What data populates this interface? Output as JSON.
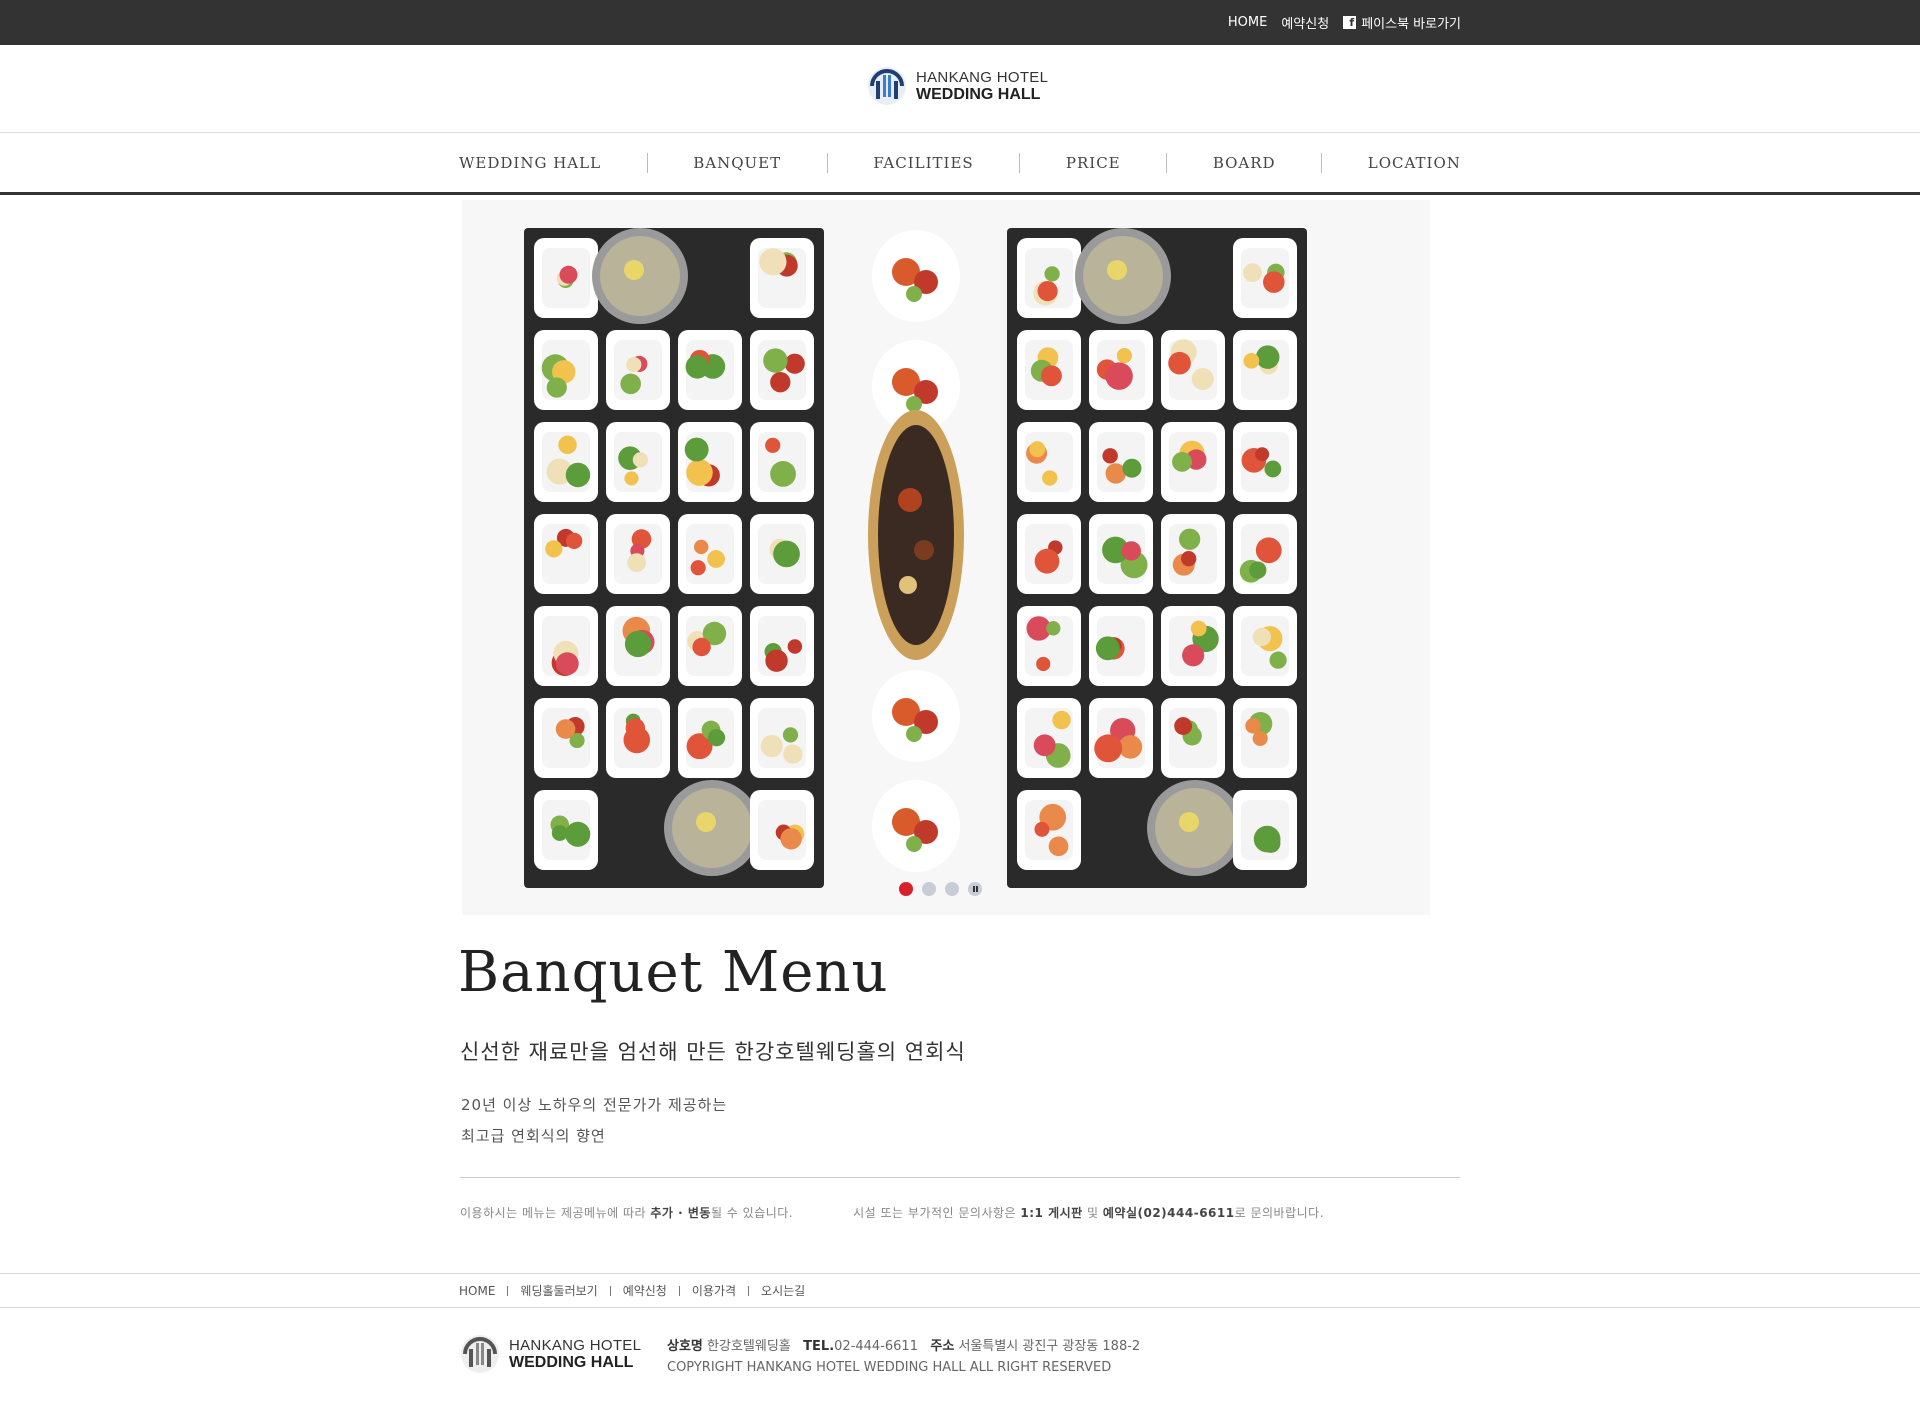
{
  "topbar": {
    "home": "HOME",
    "reserve": "예약신청",
    "facebook_icon": "f",
    "facebook": "페이스북 바로가기"
  },
  "logo": {
    "line1": "HANKANG HOTEL",
    "line2": "WEDDING HALL"
  },
  "nav": {
    "items": [
      "WEDDING HALL",
      "BANQUET",
      "FACILITIES",
      "PRICE",
      "BOARD",
      "LOCATION"
    ]
  },
  "slider": {
    "dots": 3,
    "active_index": 0
  },
  "content": {
    "title": "Banquet Menu",
    "subtitle": "신선한 재료만을 엄선해 만든 한강호텔웨딩홀의 연회식",
    "desc_line1": "20년 이상 노하우의 전문가가 제공하는",
    "desc_line2": "최고급 연회식의 향연",
    "notice1_a": "이용하시는 메뉴는 제공메뉴에 따라 ",
    "notice1_b": "추가 · 변동",
    "notice1_c": "될 수 있습니다.",
    "notice2_a": "시설 또는 부가적인 문의사항은 ",
    "notice2_b": "1:1 게시판",
    "notice2_c": " 및 ",
    "notice2_d": "예약실(02)444-6611",
    "notice2_e": "로 문의바랍니다."
  },
  "footer_nav": [
    "HOME",
    "웨딩홀둘러보기",
    "예약신청",
    "이용가격",
    "오시는길"
  ],
  "footer": {
    "name_label": "상호명",
    "name_value": "한강호텔웨딩홀",
    "tel_label": "TEL.",
    "tel_value": "02-444-6611",
    "addr_label": "주소",
    "addr_value": "서울특별시 광진구 광장동 188-2",
    "copyright": "COPYRIGHT HANKANG HOTEL WEDDING HALL ALL RIGHT RESERVED"
  },
  "colors": {
    "topbar": "#333333",
    "accent_red": "#d9202a",
    "dot_inactive": "#c7ccd6"
  }
}
